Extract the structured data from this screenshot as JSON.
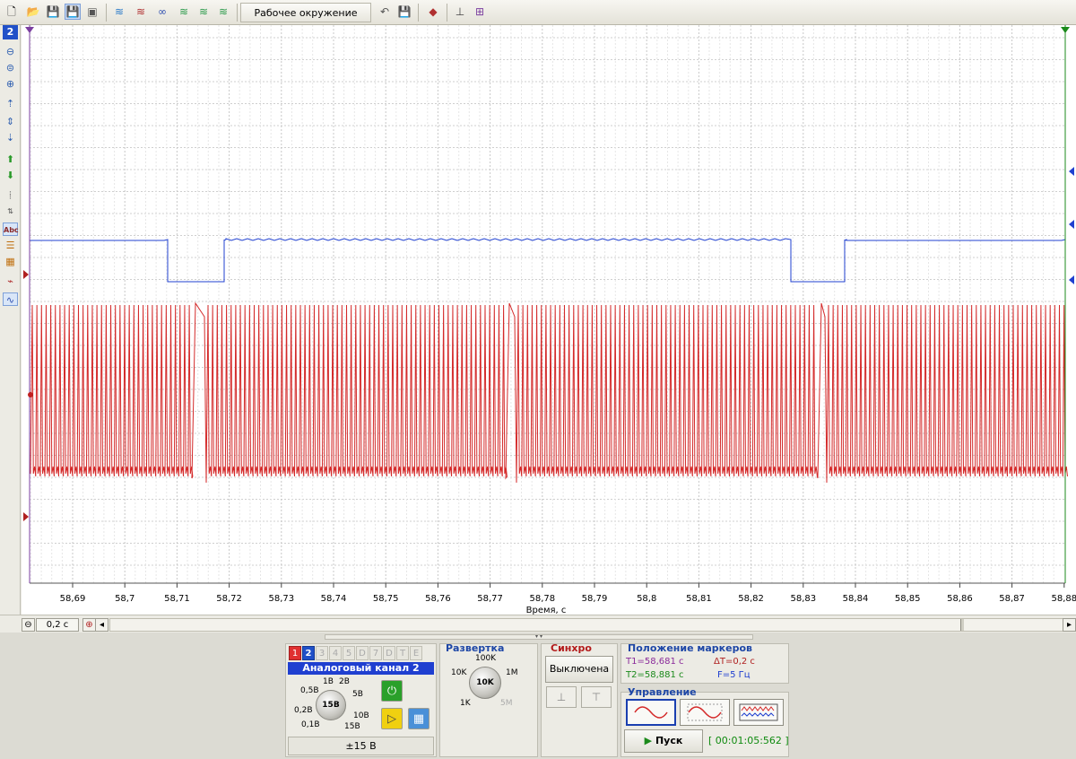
{
  "toolbar": {
    "workspace_label": "Рабочее окружение"
  },
  "left_toolbar": {
    "channel_number": "2",
    "label_text": "Abc"
  },
  "plot": {
    "x_axis_label": "Время, с",
    "x_ticks": [
      "58,69",
      "58,7",
      "58,71",
      "58,72",
      "58,73",
      "58,74",
      "58,75",
      "58,76",
      "58,77",
      "58,78",
      "58,79",
      "58,8",
      "58,81",
      "58,82",
      "58,83",
      "58,84",
      "58,85",
      "58,86",
      "58,87",
      "58,88"
    ],
    "colors": {
      "channel1": "#d42a2a",
      "channel2": "#2040d0",
      "grid": "#cfcfcf",
      "marker_start": "#7b3fa0",
      "marker_end": "#1b8a1b"
    }
  },
  "hscroll": {
    "time_scale": "0,2 с"
  },
  "channel_panel": {
    "tabs": [
      "1",
      "2",
      "3",
      "4",
      "5",
      "D",
      "7",
      "D",
      "T",
      "E"
    ],
    "active_tab": "2",
    "title": "Аналоговый канал 2",
    "knob_labels": [
      "1В",
      "2В",
      "0,5В",
      "5В",
      "0,2В",
      "10В",
      "0,1В",
      "15В"
    ],
    "knob_value": "15В",
    "range": "±15 В"
  },
  "sweep_panel": {
    "title": "Развертка",
    "knob_labels": [
      "100K",
      "10K",
      "1M",
      "1K",
      "5M"
    ],
    "knob_value": "10K"
  },
  "sync_panel": {
    "title": "Синхро",
    "state": "Выключена"
  },
  "markers_panel": {
    "title": "Положение маркеров",
    "t1": "T1=58,681 с",
    "t2": "T2=58,881 с",
    "dt": "ΔT=0,2 с",
    "f": "F=5 Гц"
  },
  "control_panel": {
    "title": "Управление",
    "run_label": "Пуск",
    "timer": "[ 00:01:05:562 ]"
  }
}
